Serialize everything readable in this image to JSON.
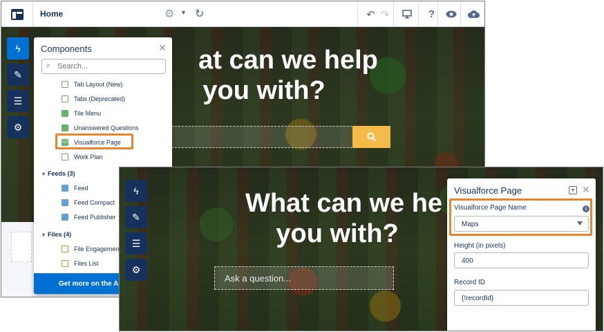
{
  "builder": {
    "page_name": "Home",
    "toolbar_icons": [
      "undo-icon",
      "redo-icon",
      "desktop-icon",
      "help-icon",
      "preview-icon",
      "publish-icon"
    ],
    "help_glyph": "?"
  },
  "hero": {
    "headline_line1_partial": "at can we help",
    "headline_line2": "you with?",
    "headline_line1_cut": "What can we he",
    "question_placeholder": "Ask a question..."
  },
  "components_panel": {
    "title": "Components",
    "search_placeholder": "Search...",
    "items_top": [
      "Tab Layout (New)",
      "Tabs (Deprecated)",
      "Tile Menu",
      "Unanswered Questions",
      "Visualforce Page",
      "Work Plan"
    ],
    "feeds_section": "Feeds (3)",
    "feeds_items": [
      "Feed",
      "Feed Compact",
      "Feed Publisher"
    ],
    "files_section": "Files (4)",
    "files_items": [
      "File Engagement",
      "Files List"
    ],
    "footer": "Get more on the AppExchange"
  },
  "properties_panel": {
    "title": "Visualforce Page",
    "page_name_label": "Visualforce Page Name",
    "page_name_value": "Maps",
    "height_label": "Height (in pixels)",
    "height_value": "400",
    "record_id_label": "Record ID",
    "record_id_value": "{!recordId}"
  },
  "colors": {
    "highlight": "#e8852b",
    "rail": "#16325c",
    "rail_active": "#0070d2",
    "search_button": "#f4bb4b"
  }
}
